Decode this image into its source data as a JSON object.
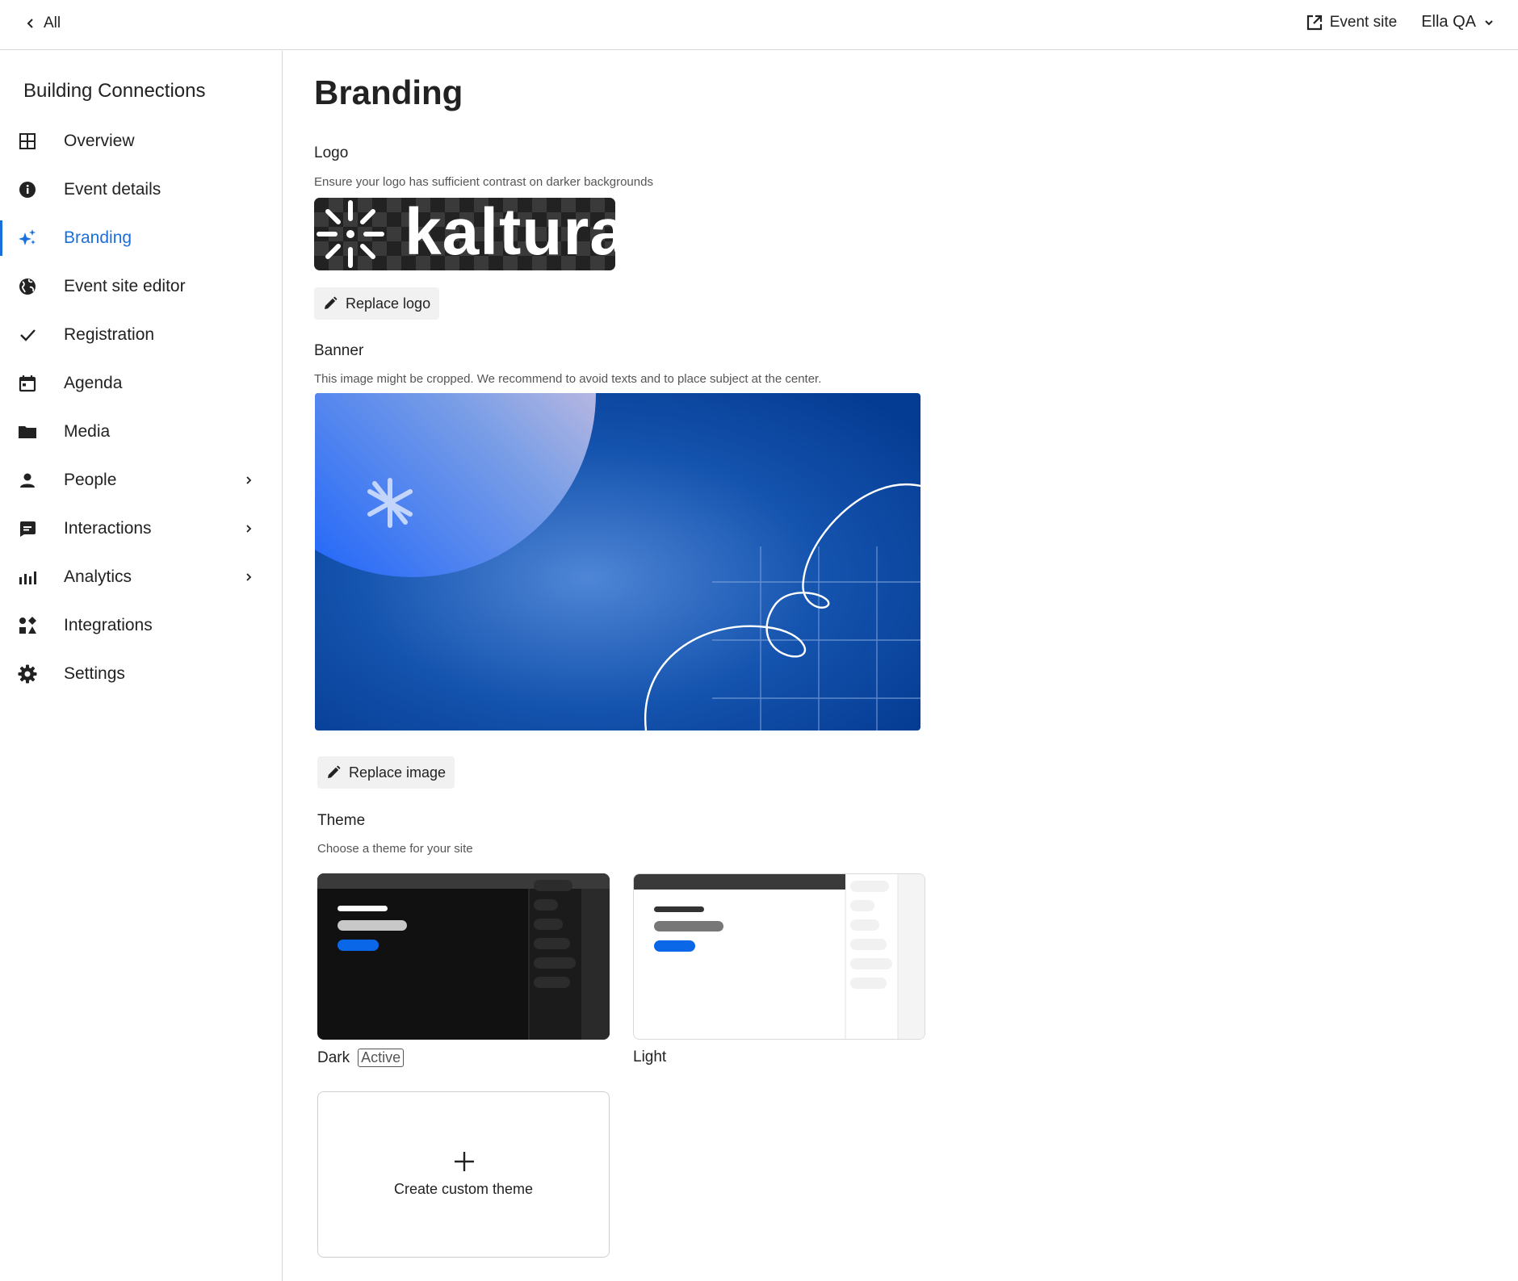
{
  "topbar": {
    "back_label": "All",
    "event_site_label": "Event site",
    "user_name": "Ella QA"
  },
  "sidebar": {
    "event_name": "Building Connections",
    "items": [
      {
        "label": "Overview",
        "icon": "grid-icon"
      },
      {
        "label": "Event details",
        "icon": "info-icon"
      },
      {
        "label": "Branding",
        "icon": "sparkle-icon",
        "active": true
      },
      {
        "label": "Event site editor",
        "icon": "globe-icon"
      },
      {
        "label": "Registration",
        "icon": "check-icon"
      },
      {
        "label": "Agenda",
        "icon": "calendar-icon"
      },
      {
        "label": "Media",
        "icon": "folder-icon"
      },
      {
        "label": "People",
        "icon": "person-icon",
        "has_submenu": true
      },
      {
        "label": "Interactions",
        "icon": "chat-icon",
        "has_submenu": true
      },
      {
        "label": "Analytics",
        "icon": "bar-chart-icon",
        "has_submenu": true
      },
      {
        "label": "Integrations",
        "icon": "shapes-icon"
      },
      {
        "label": "Settings",
        "icon": "gear-icon"
      }
    ]
  },
  "main": {
    "title": "Branding",
    "logo": {
      "label": "Logo",
      "description": "Ensure your logo has sufficient contrast on darker backgrounds",
      "logo_text": "kaltura",
      "replace_label": "Replace logo"
    },
    "banner": {
      "label": "Banner",
      "description": "This image might be cropped. We recommend to avoid texts and to place subject at the center.",
      "replace_label": "Replace image"
    },
    "theme": {
      "label": "Theme",
      "description": "Choose a theme for your site",
      "options": [
        {
          "name": "Dark",
          "badge": "Active"
        },
        {
          "name": "Light"
        }
      ],
      "custom_label": "Create custom theme"
    }
  },
  "colors": {
    "accent": "#1a6fdc",
    "dark_theme_bg": "#111111",
    "light_theme_bg": "#ffffff",
    "banner_blue": "#0b4ba8"
  }
}
